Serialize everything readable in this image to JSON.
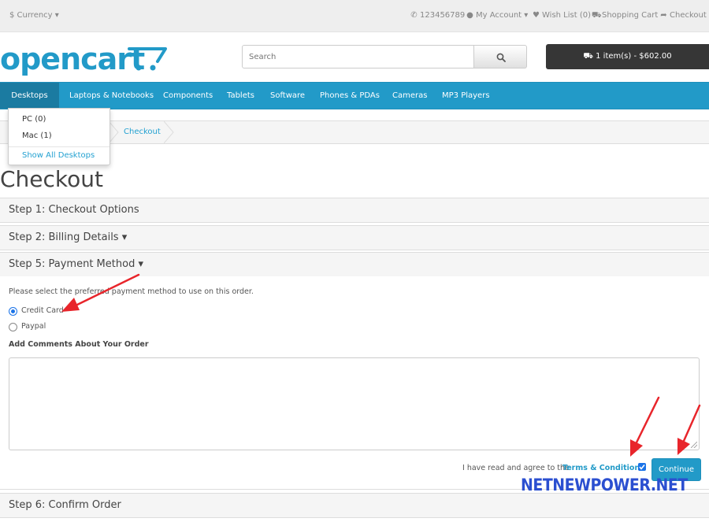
{
  "topbar": {
    "currency": "$ Currency",
    "phone": "123456789",
    "my_account": "My Account",
    "wish_list": "Wish List (0)",
    "shopping_cart": "Shopping Cart",
    "checkout": "Checkout"
  },
  "header": {
    "logo_text": "opencart",
    "search_placeholder": "Search",
    "cart_button": "1 item(s) - $602.00"
  },
  "menu": {
    "items": [
      "Desktops",
      "Laptops & Notebooks",
      "Components",
      "Tablets",
      "Software",
      "Phones & PDAs",
      "Cameras",
      "MP3 Players"
    ],
    "dropdown": {
      "items": [
        "PC (0)",
        "Mac (1)"
      ],
      "show_all": "Show All Desktops"
    }
  },
  "breadcrumb": {
    "current": "Checkout"
  },
  "page": {
    "title": "Checkout"
  },
  "steps": {
    "step1": "Step 1: Checkout Options",
    "step2": "Step 2: Billing Details",
    "step5": "Step 5: Payment Method",
    "step6": "Step 6: Confirm Order"
  },
  "payment": {
    "instruction": "Please select the preferred payment method to use on this order.",
    "methods": [
      "Credit Card",
      "Paypal"
    ],
    "selected": "Credit Card",
    "comments_label": "Add Comments About Your Order",
    "comments_value": "",
    "agree_text": "I have read and agree to the",
    "terms_link": "Terms & Conditions",
    "agree_checked": true,
    "continue_label": "Continue"
  },
  "watermark": "NETNEWPOWER.NET",
  "colors": {
    "brand_blue": "#229ac8",
    "menu_active": "#1b7ba1",
    "cart_dark": "#363636",
    "annotation_red": "#e8252b",
    "watermark_blue": "#2b4fd0"
  }
}
